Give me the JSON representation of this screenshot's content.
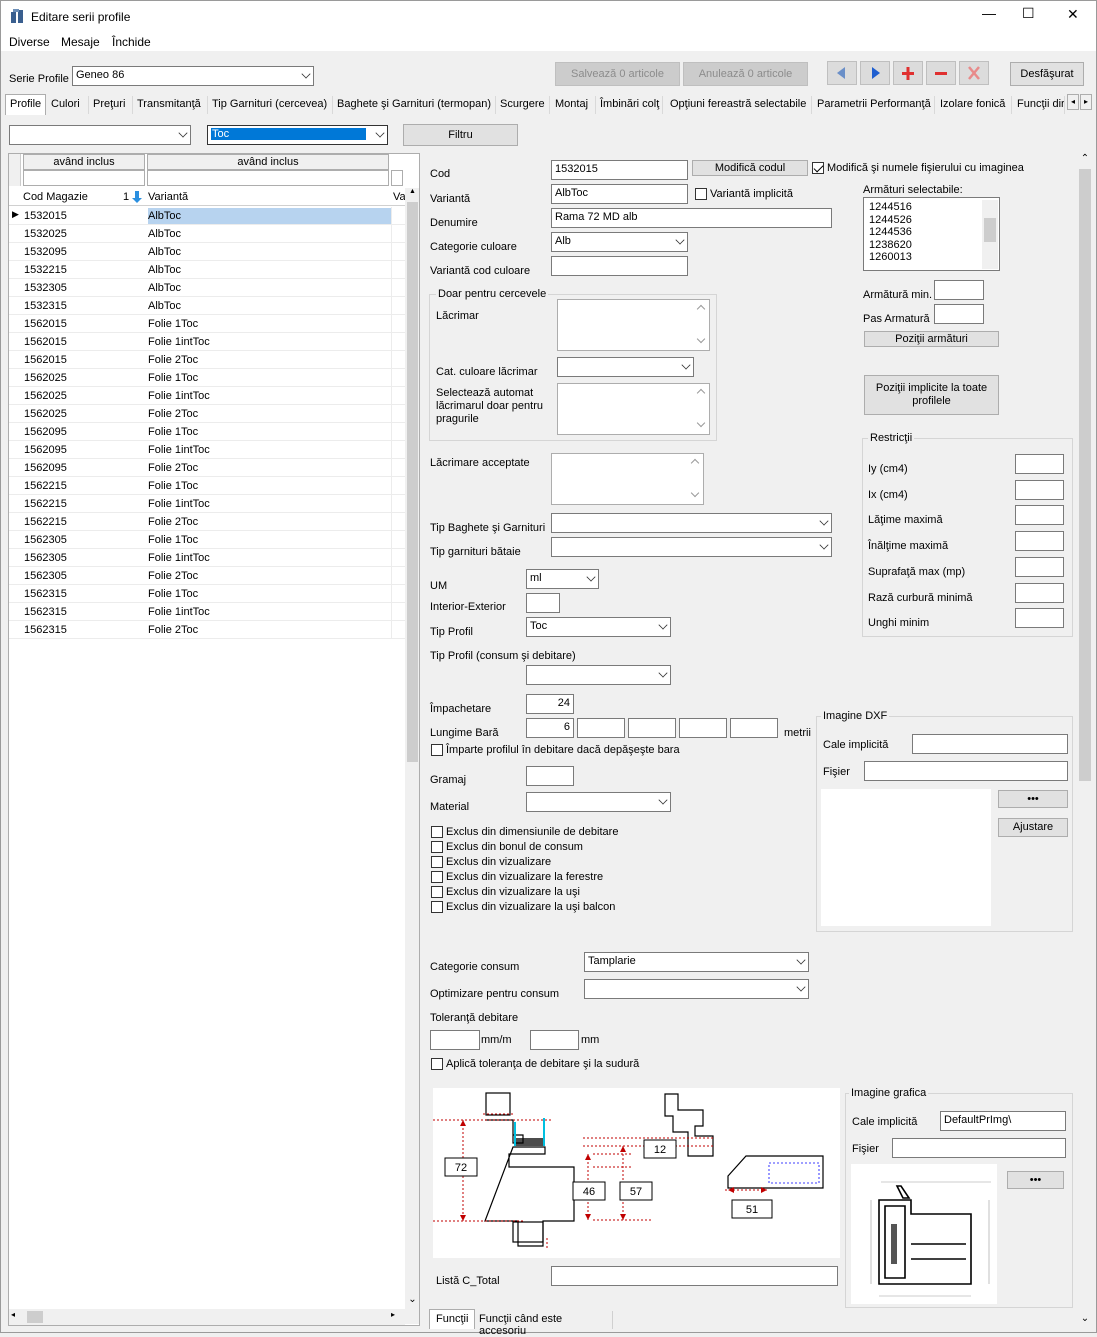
{
  "window": {
    "title": "Editare serii profile",
    "min": "—",
    "max": "☐",
    "close": "✕"
  },
  "menu": [
    "Diverse",
    "Mesaje",
    "Închide"
  ],
  "toolbar": {
    "serie_label": "Serie Profile",
    "serie_value": "Geneo 86",
    "save": "Salvează 0 articole",
    "cancel": "Anulează 0 articole",
    "expand": "Desfăşurat"
  },
  "tabs": [
    "Profile",
    "Culori",
    "Preţuri",
    "Transmitanţă",
    "Tip Garnituri (cercevea)",
    "Baghete şi Garnituri (termopan)",
    "Scurgere",
    "Montaj",
    "Îmbinări colţ",
    "Opţiuni fereastră selectabile",
    "Parametrii Performanţă",
    "Izolare fonică",
    "Funcţii dir"
  ],
  "filter": {
    "left_value": "",
    "right_value": "Toc",
    "button": "Filtru"
  },
  "grid": {
    "filter_header_1": "având inclus",
    "filter_header_2": "având inclus",
    "col_code": "Cod Magazie",
    "col_sort": "1",
    "col_variant": "Variantă",
    "col_extra": "Va",
    "rows": [
      [
        "1532015",
        "AlbToc"
      ],
      [
        "1532025",
        "AlbToc"
      ],
      [
        "1532095",
        "AlbToc"
      ],
      [
        "1532215",
        "AlbToc"
      ],
      [
        "1532305",
        "AlbToc"
      ],
      [
        "1532315",
        "AlbToc"
      ],
      [
        "1562015",
        "Folie 1Toc"
      ],
      [
        "1562015",
        "Folie 1intToc"
      ],
      [
        "1562015",
        "Folie 2Toc"
      ],
      [
        "1562025",
        "Folie 1Toc"
      ],
      [
        "1562025",
        "Folie 1intToc"
      ],
      [
        "1562025",
        "Folie 2Toc"
      ],
      [
        "1562095",
        "Folie 1Toc"
      ],
      [
        "1562095",
        "Folie 1intToc"
      ],
      [
        "1562095",
        "Folie 2Toc"
      ],
      [
        "1562215",
        "Folie 1Toc"
      ],
      [
        "1562215",
        "Folie 1intToc"
      ],
      [
        "1562215",
        "Folie 2Toc"
      ],
      [
        "1562305",
        "Folie 1Toc"
      ],
      [
        "1562305",
        "Folie 1intToc"
      ],
      [
        "1562305",
        "Folie 2Toc"
      ],
      [
        "1562315",
        "Folie 1Toc"
      ],
      [
        "1562315",
        "Folie 1intToc"
      ],
      [
        "1562315",
        "Folie 2Toc"
      ]
    ]
  },
  "form": {
    "cod_label": "Cod",
    "cod_value": "1532015",
    "modify_code": "Modifică codul",
    "modify_names": "Modifică şi numele fişierului cu imaginea",
    "varianta_label": "Variantă",
    "varianta_value": "AlbToc",
    "implicit": "Variantă implicită",
    "denumire_label": "Denumire",
    "denumire_value": "Rama 72 MD alb",
    "categorie_label": "Categorie culoare",
    "categorie_value": "Alb",
    "var_cod_label": "Variantă cod culoare",
    "cercevele_group": "Doar pentru cercevele",
    "lacrimar_label": "Lăcrimar",
    "cat_lacrimar_label": "Cat. culoare lăcrimar",
    "select_auto_label": "Selectează automat lăcrimarul doar pentru pragurile",
    "lacrimare_acc_label": "Lăcrimare acceptate",
    "tip_baghete_label": "Tip Baghete şi Garnituri",
    "tip_garn_label": "Tip garnituri bătaie",
    "um_label": "UM",
    "um_value": "ml",
    "int_ext_label": "Interior-Exterior",
    "tip_profil_label": "Tip Profil",
    "tip_profil_value": "Toc",
    "tip_profil_cons_label": "Tip Profil (consum şi debitare)",
    "impachetare_label": "Împachetare",
    "impachetare_value": "24",
    "lungime_label": "Lungime Bară",
    "lungime_value": "6",
    "metrii": "metrii",
    "imparte": "Împarte profilul în debitare dacă depăşeşte bara",
    "gramaj_label": "Gramaj",
    "material_label": "Material",
    "checks": [
      "Exclus din dimensiunile de debitare",
      "Exclus din bonul de consum",
      "Exclus din vizualizare",
      "Exclus din vizualizare la ferestre",
      "Exclus din vizualizare la uşi",
      "Exclus din vizualizare la uşi balcon"
    ],
    "cat_consum_label": "Categorie consum",
    "cat_consum_value": "Tamplarie",
    "optim_label": "Optimizare pentru consum",
    "toleranta_label": "Toleranţă debitare",
    "mmm": "mm/m",
    "mm": "mm",
    "aplica": "Aplică toleranţa de debitare şi la sudură",
    "lista_label": "Listă C_Total"
  },
  "armaturi": {
    "label": "Armături selectabile:",
    "items": [
      "1244516",
      "1244526",
      "1244536",
      "1238620",
      "1260013"
    ],
    "min_label": "Armătură min.",
    "pas_label": "Pas Armatură",
    "pozitii": "Poziţii armături",
    "pozitii_impl": "Poziţii implicite la toate profilele"
  },
  "restrictii": {
    "title": "Restricţii",
    "items": [
      "Iy (cm4)",
      "Ix (cm4)",
      "Lăţime maximă",
      "Înălţime maximă",
      "Suprafaţă max (mp)",
      "Rază curbură minimă",
      "Unghi minim"
    ]
  },
  "dxf": {
    "title": "Imagine DXF",
    "cale_label": "Cale implicită",
    "fisier_label": "Fişier",
    "dots": "•••",
    "ajustare": "Ajustare"
  },
  "grafica": {
    "title": "Imagine grafica",
    "cale_label": "Cale implicită",
    "cale_value": "DefaultPrImg\\",
    "fisier_label": "Fişier",
    "dots": "•••"
  },
  "drawing": {
    "dims": [
      "72",
      "12",
      "46",
      "57",
      "51"
    ]
  },
  "bottom_tabs": [
    "Funcţii",
    "Funcţii când este accesoriu"
  ]
}
